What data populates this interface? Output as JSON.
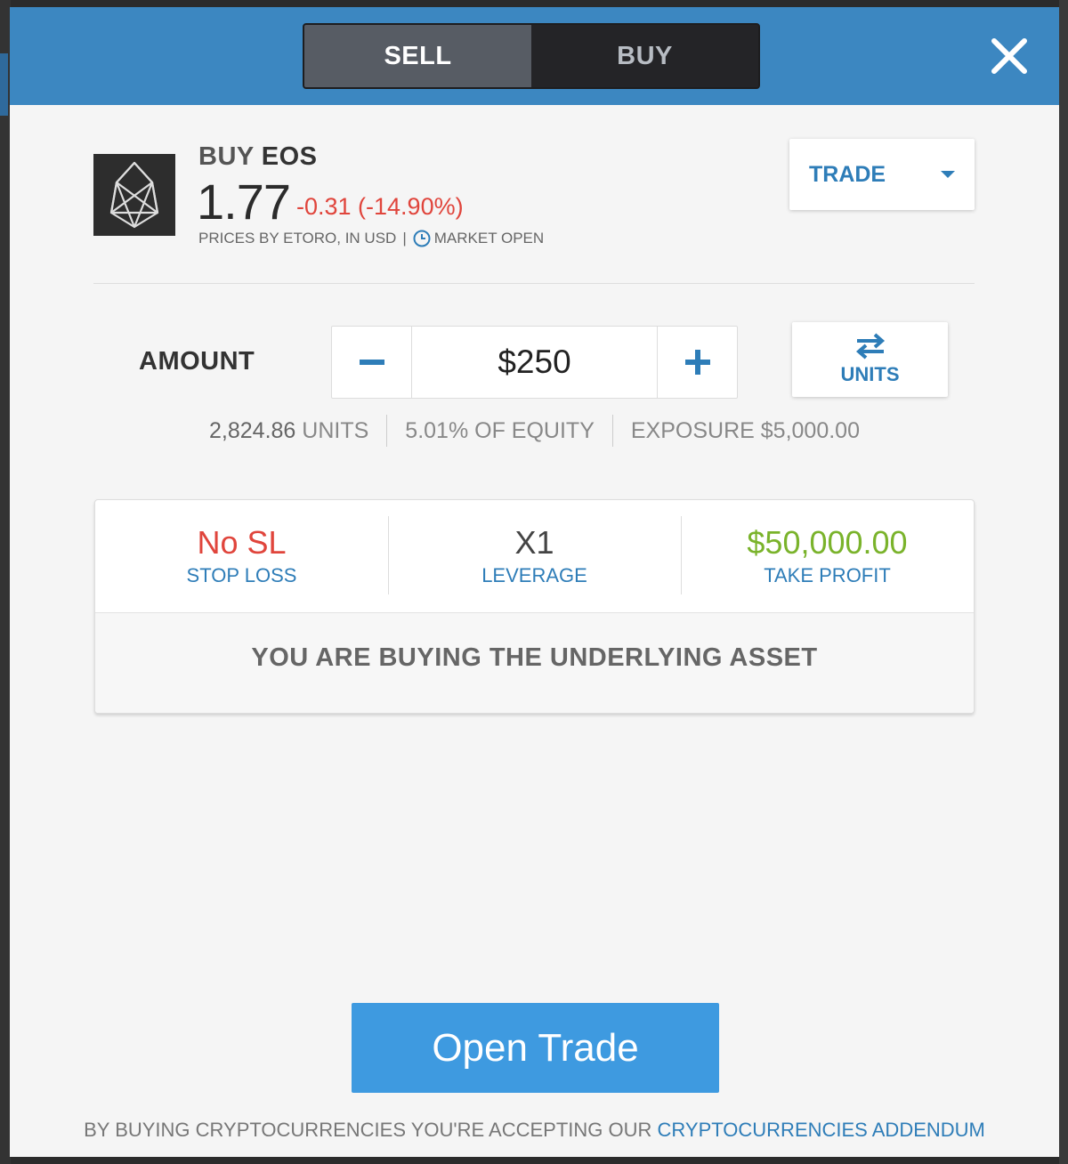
{
  "colors": {
    "header_blue": "#3c87c1",
    "accent_blue": "#2e7db8",
    "negative_red": "#e0453c",
    "positive_green": "#7ab32b",
    "open_trade_button": "#3e9ae0"
  },
  "header": {
    "sell_label": "SELL",
    "buy_label": "BUY",
    "active_side": "SELL",
    "close_icon": "close-icon"
  },
  "asset": {
    "logo_icon": "eos-logo-icon",
    "action": "BUY",
    "symbol": "EOS",
    "price": "1.77",
    "change": "-0.31 (-14.90%)",
    "source_text": "PRICES BY ETORO, IN USD",
    "separator": "|",
    "market_status_icon": "clock-icon",
    "market_status": "MARKET OPEN"
  },
  "order_type": {
    "label": "TRADE",
    "icon": "caret-down-icon"
  },
  "amount": {
    "label": "AMOUNT",
    "value": "$250",
    "minus_icon": "minus-icon",
    "plus_icon": "plus-icon",
    "toggle_icon": "swap-arrows-icon",
    "toggle_label": "UNITS"
  },
  "summary": {
    "units_value": "2,824.86",
    "units_label": "UNITS",
    "equity_value": "5.01%",
    "equity_label": "OF EQUITY",
    "exposure_label": "EXPOSURE",
    "exposure_value": "$5,000.00"
  },
  "risk": {
    "stop_loss_value": "No SL",
    "stop_loss_label": "STOP LOSS",
    "leverage_value": "X1",
    "leverage_label": "LEVERAGE",
    "take_profit_value": "$50,000.00",
    "take_profit_label": "TAKE PROFIT",
    "notice": "YOU ARE BUYING THE UNDERLYING ASSET"
  },
  "open_trade_label": "Open Trade",
  "footer": {
    "text": "BY BUYING CRYPTOCURRENCIES YOU'RE ACCEPTING OUR",
    "link": "CRYPTOCURRENCIES ADDENDUM"
  }
}
